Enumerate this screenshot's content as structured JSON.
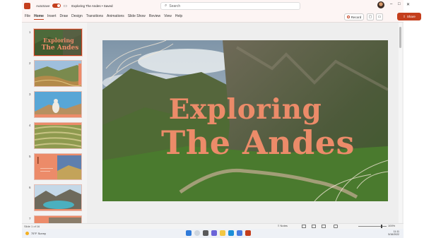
{
  "titlebar": {
    "autosave_label": "AutoSave",
    "toggle_state": "On",
    "document_title": "Exploring The Andes • Saved",
    "search_placeholder": "Search"
  },
  "ribbon": {
    "tabs": [
      "File",
      "Home",
      "Insert",
      "Draw",
      "Design",
      "Transitions",
      "Animations",
      "Slide Show",
      "Review",
      "View",
      "Help"
    ],
    "active_tab": "Home",
    "record_label": "Record",
    "share_label": "Share"
  },
  "thumbnails": {
    "numbers": [
      "1",
      "2",
      "3",
      "4",
      "5",
      "6",
      "7"
    ],
    "slide1_title_1": "Exploring",
    "slide1_title_2": "The Andes"
  },
  "slide": {
    "title_line1": "Exploring",
    "title_line2": "The Andes"
  },
  "statusbar": {
    "slide_info": "Slide 1 of 16",
    "notes_label": "Notes",
    "zoom": "100%"
  },
  "taskbar": {
    "weather": "75°F Sunny",
    "time": "11:11",
    "date": "5/16/2022"
  },
  "colors": {
    "accent": "#c43e1c",
    "title_color": "#ec8b69",
    "thumb_salmon": "#ec8b69"
  }
}
